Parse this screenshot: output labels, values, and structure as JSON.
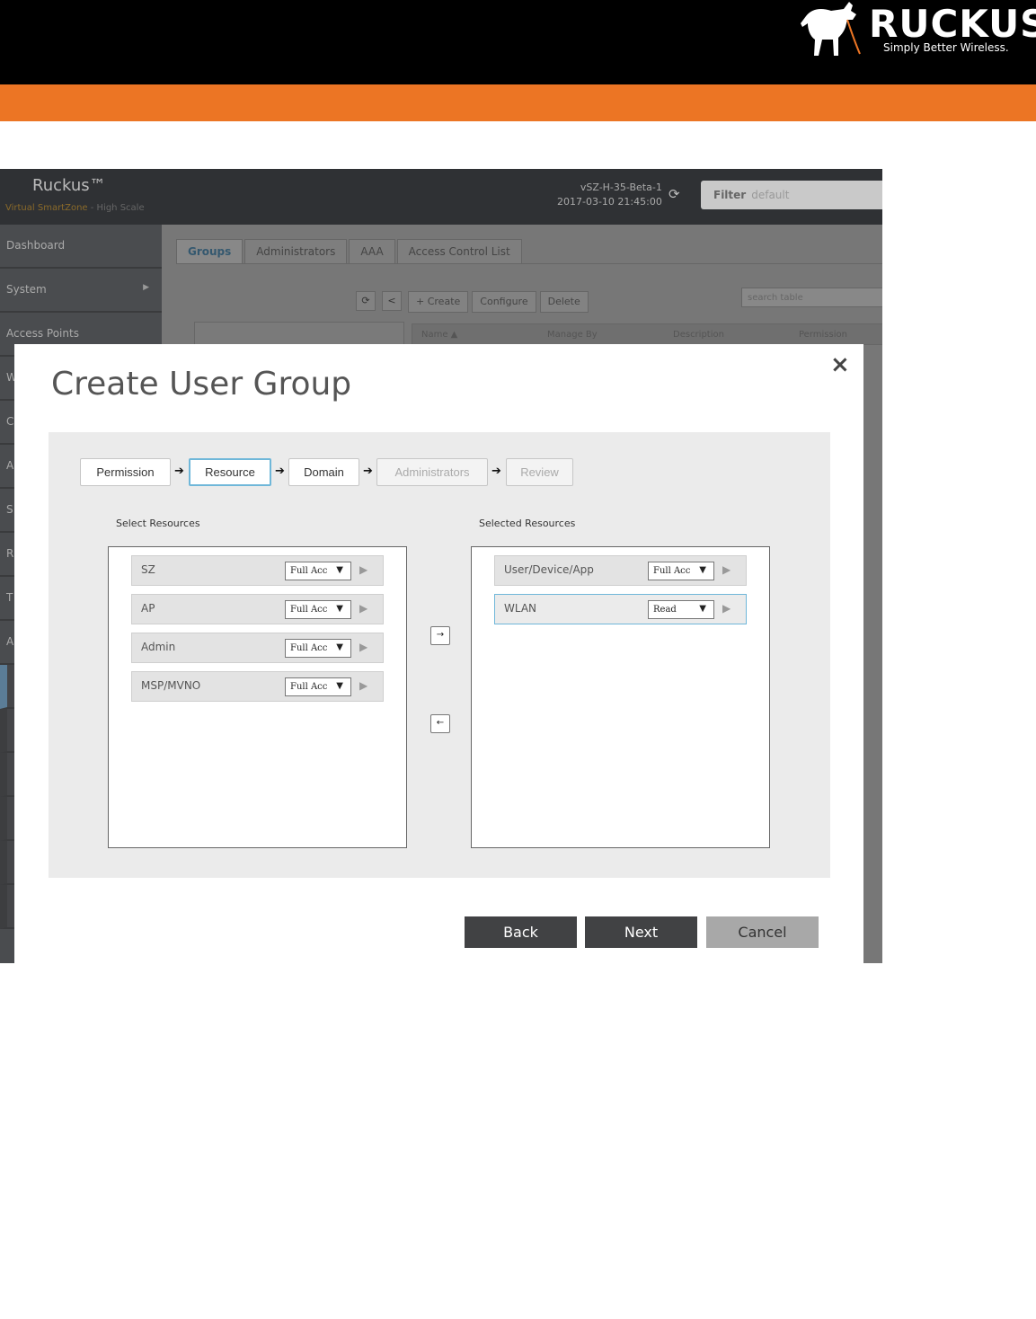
{
  "brand": {
    "word": "RUCKUS",
    "tagline": "Simply Better Wireless."
  },
  "app": {
    "logo": "Ruckus™",
    "subtitle_product": "Virtual SmartZone",
    "subtitle_scale": " - High Scale",
    "host": "vSZ-H-35-Beta-1",
    "datetime": "2017-03-10  21:45:00",
    "filter_label": "Filter",
    "filter_value": "default",
    "sidebar": [
      {
        "label": "Dashboard"
      },
      {
        "label": "System",
        "arrow": "▶"
      },
      {
        "label": "Access Points"
      },
      {
        "label": "W"
      },
      {
        "label": "C"
      },
      {
        "label": "A"
      },
      {
        "label": "S"
      },
      {
        "label": "R"
      },
      {
        "label": "T"
      },
      {
        "label": "A"
      }
    ],
    "tabs": [
      "Groups",
      "Administrators",
      "AAA",
      "Access Control List"
    ],
    "toolbar": {
      "create": "Create",
      "configure": "Configure",
      "delete": "Delete",
      "search_placeholder": "search table"
    },
    "columns": [
      "Name ▲",
      "Manage By",
      "Description",
      "Permission"
    ]
  },
  "modal": {
    "title": "Create User Group",
    "close": "×",
    "steps": [
      "Permission",
      "Resource",
      "Domain",
      "Administrators",
      "Review"
    ],
    "select_label": "Select Resources",
    "selected_label": "Selected Resources",
    "available": [
      {
        "name": "SZ",
        "access": "Full Acc"
      },
      {
        "name": "AP",
        "access": "Full Acc"
      },
      {
        "name": "Admin",
        "access": "Full Acc"
      },
      {
        "name": "MSP/MVNO",
        "access": "Full Acc"
      }
    ],
    "selected": [
      {
        "name": "User/Device/App",
        "access": "Full Acc"
      },
      {
        "name": "WLAN",
        "access": "Read"
      }
    ],
    "add_icon": "→",
    "remove_icon": "←",
    "back": "Back",
    "next": "Next",
    "cancel": "Cancel"
  }
}
